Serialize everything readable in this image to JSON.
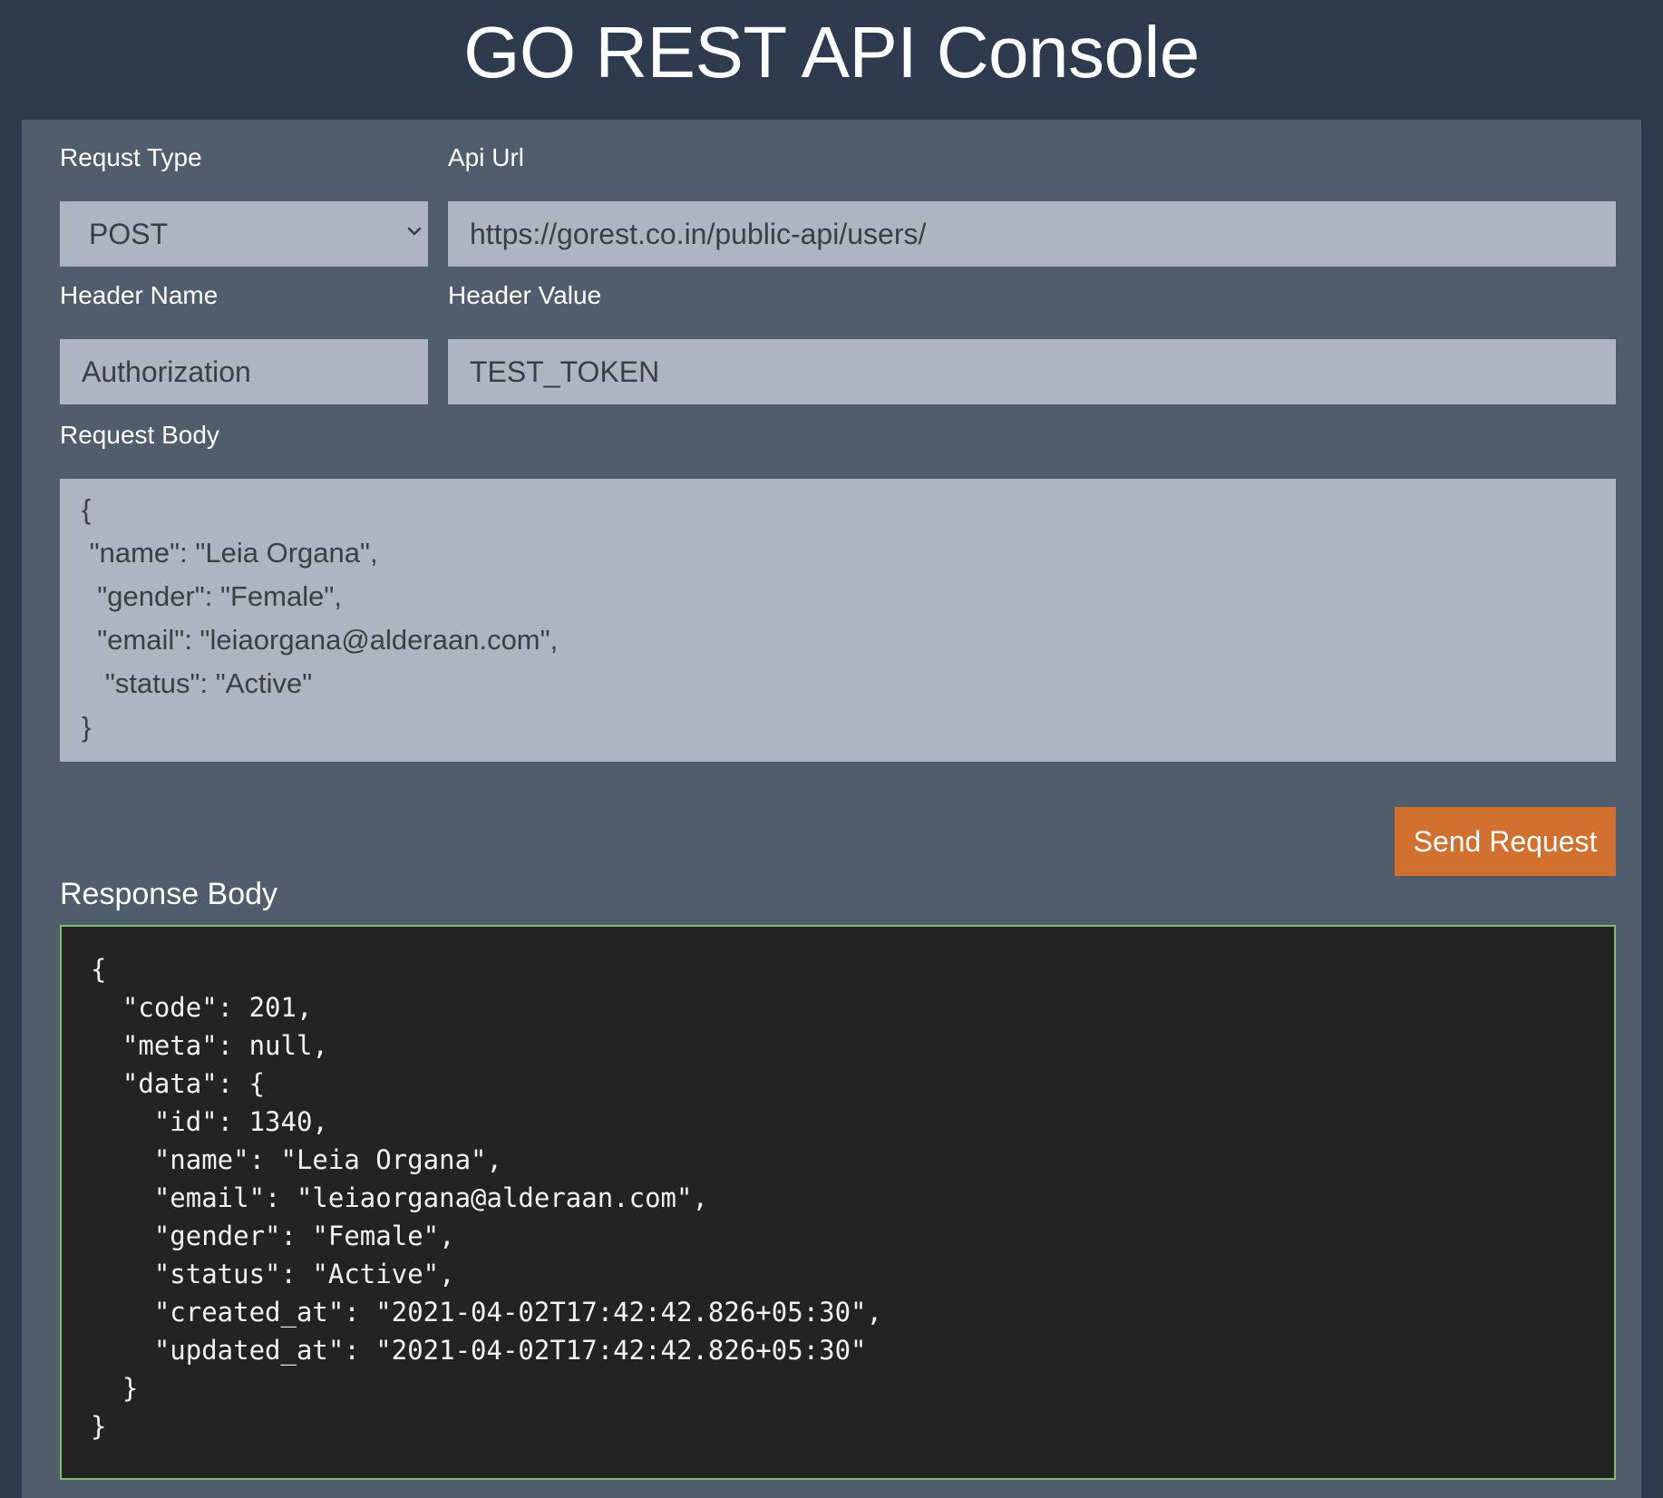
{
  "header": {
    "title": "GO REST API Console"
  },
  "form": {
    "request_type": {
      "label": "Requst Type",
      "value": "POST"
    },
    "api_url": {
      "label": "Api Url",
      "value": "https://gorest.co.in/public-api/users/"
    },
    "header_name": {
      "label": "Header Name",
      "value": "Authorization"
    },
    "header_value": {
      "label": "Header Value",
      "value": "TEST_TOKEN"
    },
    "request_body": {
      "label": "Request Body",
      "value": "{\n \"name\": \"Leia Organa\",\n  \"gender\": \"Female\",\n  \"email\": \"leiaorgana@alderaan.com\",\n   \"status\": \"Active\"\n}"
    },
    "send_label": "Send Request"
  },
  "response": {
    "label": "Response Body",
    "body": "{\n  \"code\": 201,\n  \"meta\": null,\n  \"data\": {\n    \"id\": 1340,\n    \"name\": \"Leia Organa\",\n    \"email\": \"leiaorgana@alderaan.com\",\n    \"gender\": \"Female\",\n    \"status\": \"Active\",\n    \"created_at\": \"2021-04-02T17:42:42.826+05:30\",\n    \"updated_at\": \"2021-04-02T17:42:42.826+05:30\"\n  }\n}"
  },
  "icons": {
    "select_arrow": "chevron-down-icon"
  },
  "colors": {
    "background": "#2e3b4e",
    "panel": "#505d6c",
    "field": "#aeb5c1",
    "accent": "#d2712f",
    "response_bg": "#232323",
    "response_border": "#7cbf6a"
  }
}
